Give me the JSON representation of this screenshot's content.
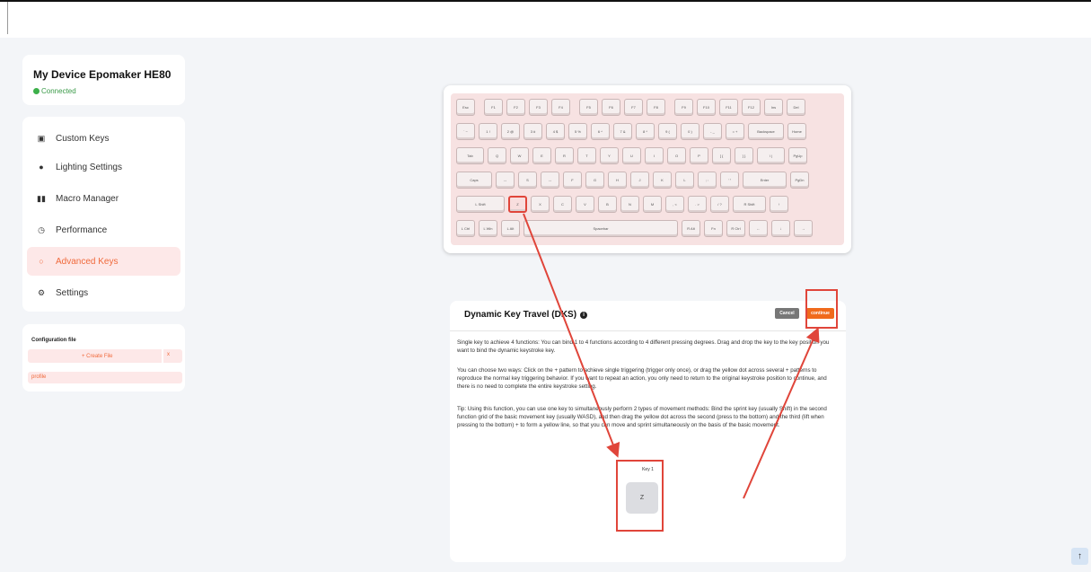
{
  "device": {
    "name": "My Device Epomaker HE80",
    "status": "Connected"
  },
  "menu": {
    "items": [
      {
        "label": "Custom Keys",
        "icon": "save-icon"
      },
      {
        "label": "Lighting Settings",
        "icon": "bulb-icon"
      },
      {
        "label": "Macro Manager",
        "icon": "macro-icon"
      },
      {
        "label": "Performance",
        "icon": "gauge-icon"
      },
      {
        "label": "Advanced Keys",
        "icon": "circle-icon",
        "active": true
      },
      {
        "label": "Settings",
        "icon": "gear-icon"
      }
    ]
  },
  "config": {
    "title": "Configuration file",
    "create_label": "+ Create File",
    "import_icon": "x",
    "profile": "profile"
  },
  "keyboard": {
    "rows": [
      [
        "Esc",
        "F1",
        "F2",
        "F3",
        "F4",
        "F5",
        "F6",
        "F7",
        "F8",
        "F9",
        "F10",
        "F11",
        "F12",
        "Ins",
        "Del"
      ],
      [
        "` ~",
        "1 !",
        "2 @",
        "3 #",
        "4 $",
        "5 %",
        "6 ^",
        "7 &",
        "8 *",
        "9 (",
        "0 )",
        "- _",
        "= +",
        "Backspace",
        "Home"
      ],
      [
        "Tab",
        "Q",
        "W",
        "E",
        "R",
        "T",
        "Y",
        "U",
        "I",
        "O",
        "P",
        "[ {",
        "] }",
        "\\ |",
        "PgUp"
      ],
      [
        "Caps",
        "↔",
        "S",
        "↔",
        "F",
        "G",
        "H",
        "J",
        "K",
        "L",
        "; :",
        "' \"",
        "Enter",
        "PgDn"
      ],
      [
        "L Shift",
        "Z",
        "X",
        "C",
        "V",
        "B",
        "N",
        "M",
        ", <",
        ". >",
        "/ ?",
        "R Shift",
        "↑"
      ],
      [
        "L Ctrl",
        "L Win",
        "L Alt",
        "Spacebar",
        "R Alt",
        "Fn",
        "R Ctrl",
        "←",
        "↓",
        "→"
      ]
    ],
    "selected_key": "Z"
  },
  "dks": {
    "title": "Dynamic Key Travel (DKS)",
    "cancel_label": "Cancel",
    "continue_label": "continue",
    "para1": "Single key to achieve 4 functions: You can bind 1 to 4 functions according to 4 different pressing degrees. Drag and drop the key to the key position you want to bind the dynamic keystroke key.",
    "para2": "You can choose two ways: Click on the + pattern to achieve single triggering (trigger only once), or drag the yellow dot across several + patterns to reproduce the normal key triggering behavior. If you want to repeat an action, you only need to return to the original keystroke position to continue, and there is no need to complete the entire keystroke setting.",
    "para3": "Tip: Using this function, you can use one key to simultaneously perform 2 types of movement methods: Bind the sprint key (usually Shift) in the second function grid of the basic movement key (usually WASD), and then drag the yellow dot across the second (press to the bottom) and the third (lift when pressing to the bottom) + to form a yellow line, so that you can move and sprint simultaneously on the basis of the basic movement.",
    "key_label": "Key 1",
    "key_value": "Z"
  },
  "scroll_up_icon": "↑"
}
